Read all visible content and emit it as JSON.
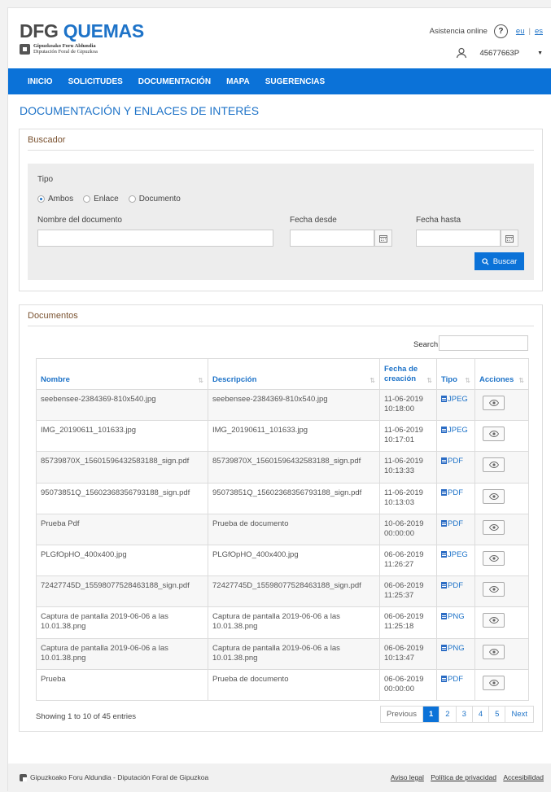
{
  "header": {
    "brand_prefix": "DFG",
    "brand_name": "QUEMAS",
    "brand_sub_line1": "Gipuzkoako Foru Aldundia",
    "brand_sub_line2": "Diputación Foral de Gipuzkoa",
    "assist_label": "Asistencia online",
    "help_glyph": "?",
    "lang_eu": "eu",
    "lang_sep": "|",
    "lang_es": "es",
    "user_id": "45677663P"
  },
  "nav": {
    "items": [
      "INICIO",
      "SOLICITUDES",
      "DOCUMENTACIÓN",
      "MAPA",
      "SUGERENCIAS"
    ]
  },
  "page_title": "DOCUMENTACIÓN Y ENLACES DE INTERÉS",
  "buscador": {
    "title": "Buscador",
    "tipo_label": "Tipo",
    "radios": [
      "Ambos",
      "Enlace",
      "Documento"
    ],
    "selected": "Ambos",
    "nombre_label": "Nombre del documento",
    "desde_label": "Fecha desde",
    "hasta_label": "Fecha hasta",
    "buscar_label": "Buscar"
  },
  "documentos": {
    "title": "Documentos",
    "search_label": "Search:",
    "columns": [
      "Nombre",
      "Descripción",
      "Fecha de creación",
      "Tipo",
      "Acciones"
    ],
    "rows": [
      {
        "nombre": "seebensee-2384369-810x540.jpg",
        "descripcion": "seebensee-2384369-810x540.jpg",
        "fecha": "11-06-2019",
        "hora": "10:18:00",
        "tipo": "JPEG"
      },
      {
        "nombre": "IMG_20190611_101633.jpg",
        "descripcion": "IMG_20190611_101633.jpg",
        "fecha": "11-06-2019",
        "hora": "10:17:01",
        "tipo": "JPEG"
      },
      {
        "nombre": "85739870X_15601596432583188_sign.pdf",
        "descripcion": "85739870X_15601596432583188_sign.pdf",
        "fecha": "11-06-2019",
        "hora": "10:13:33",
        "tipo": "PDF"
      },
      {
        "nombre": "95073851Q_15602368356793188_sign.pdf",
        "descripcion": "95073851Q_15602368356793188_sign.pdf",
        "fecha": "11-06-2019",
        "hora": "10:13:03",
        "tipo": "PDF"
      },
      {
        "nombre": "Prueba Pdf",
        "descripcion": "Prueba de documento",
        "fecha": "10-06-2019",
        "hora": "00:00:00",
        "tipo": "PDF"
      },
      {
        "nombre": "PLGfOpHO_400x400.jpg",
        "descripcion": "PLGfOpHO_400x400.jpg",
        "fecha": "06-06-2019",
        "hora": "11:26:27",
        "tipo": "JPEG"
      },
      {
        "nombre": "72427745D_15598077528463188_sign.pdf",
        "descripcion": "72427745D_15598077528463188_sign.pdf",
        "fecha": "06-06-2019",
        "hora": "11:25:37",
        "tipo": "PDF"
      },
      {
        "nombre": "Captura de pantalla 2019-06-06 a las 10.01.38.png",
        "descripcion": "Captura de pantalla 2019-06-06 a las 10.01.38.png",
        "fecha": "06-06-2019",
        "hora": "11:25:18",
        "tipo": "PNG"
      },
      {
        "nombre": "Captura de pantalla 2019-06-06 a las 10.01.38.png",
        "descripcion": "Captura de pantalla 2019-06-06 a las 10.01.38.png",
        "fecha": "06-06-2019",
        "hora": "10:13:47",
        "tipo": "PNG"
      },
      {
        "nombre": "Prueba",
        "descripcion": "Prueba de documento",
        "fecha": "06-06-2019",
        "hora": "00:00:00",
        "tipo": "PDF"
      }
    ],
    "info": "Showing 1 to 10 of 45 entries",
    "pager": [
      "Previous",
      "1",
      "2",
      "3",
      "4",
      "5",
      "Next"
    ],
    "current_page": "1"
  },
  "footer": {
    "left": "Gipuzkoako Foru Aldundia - Diputación Foral de Gipuzkoa",
    "links": [
      "Aviso legal",
      "Política de privacidad",
      "Accesibilidad"
    ]
  },
  "colors": {
    "accent": "#0b72d8",
    "link": "#1e73c8",
    "panel_title": "#7a5230"
  }
}
